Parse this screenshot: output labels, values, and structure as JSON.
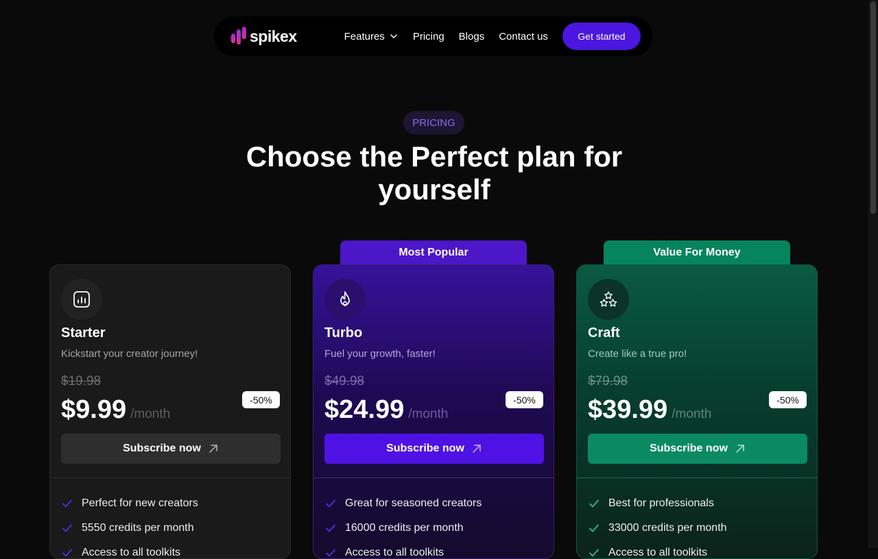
{
  "nav": {
    "logo_text": "spikex",
    "links": [
      "Features",
      "Pricing",
      "Blogs",
      "Contact us"
    ],
    "cta_label": "Get started"
  },
  "hero": {
    "badge": "PRICING",
    "title_line1": "Choose the Perfect plan for",
    "title_line2": "yourself"
  },
  "plans": [
    {
      "name": "Starter",
      "description": "Kickstart your creator journey!",
      "old_price": "$19.98",
      "price": "$9.99",
      "period": "/month",
      "discount": "-50%",
      "button_label": "Subscribe now",
      "icon": "bar-chart-icon",
      "features": [
        "Perfect for new creators",
        "5550 credits per month",
        "Access to all toolkits"
      ]
    },
    {
      "ribbon": "Most Popular",
      "name": "Turbo",
      "description": "Fuel your growth, faster!",
      "old_price": "$49.98",
      "price": "$24.99",
      "period": "/month",
      "discount": "-50%",
      "button_label": "Subscribe now",
      "icon": "flame-icon",
      "features": [
        "Great for seasoned creators",
        "16000 credits per month",
        "Access to all toolkits"
      ]
    },
    {
      "ribbon": "Value For Money",
      "name": "Craft",
      "description": "Create like a true pro!",
      "old_price": "$79.98",
      "price": "$39.99",
      "period": "/month",
      "discount": "-50%",
      "button_label": "Subscribe now",
      "icon": "stars-icon",
      "features": [
        "Best for professionals",
        "33000 credits per month",
        "Access to all toolkits"
      ]
    }
  ],
  "colors": {
    "accent_purple": "#4a16e0",
    "accent_green": "#0b8a61",
    "check_purple": "#5b2be6",
    "check_green": "#2fbf8a"
  }
}
